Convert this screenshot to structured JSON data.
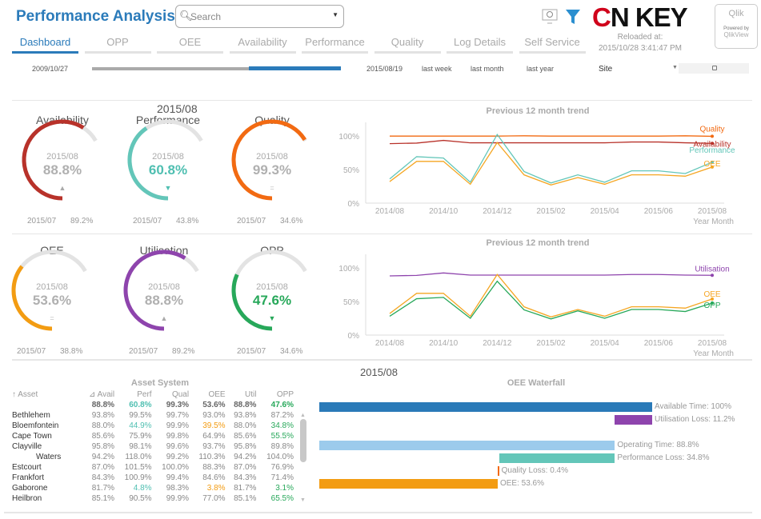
{
  "header": {
    "title": "Performance Analysis",
    "search_placeholder": "Search",
    "logo_text": "ONKEY",
    "logo_c": "C",
    "logo_rest": "N KEY",
    "qlik_brand": "Qlik",
    "qlik_powered": "Powered by",
    "qlik_product": "QlikView",
    "reloaded_label": "Reloaded at:",
    "reloaded_value": "2015/10/28  3:41:47 PM",
    "icons": [
      "monitor-search-icon",
      "filter-icon"
    ]
  },
  "tabs": [
    {
      "label": "Dashboard",
      "active": true
    },
    {
      "label": "OPP"
    },
    {
      "label": "OEE"
    },
    {
      "label": "Availability"
    },
    {
      "label": "Performance"
    },
    {
      "label": "Quality"
    },
    {
      "label": "Log Details"
    },
    {
      "label": "Self Service"
    }
  ],
  "controls": {
    "start_date": "2009/10/27",
    "end_date": "2015/08/19",
    "last_week": "last week",
    "last_month": "last month",
    "last_year": "last year",
    "site_label": "Site",
    "range_selected": [
      0.63,
      1.0
    ],
    "accent": "#2b7bba"
  },
  "gauge_header": "2015/08",
  "gauges": [
    {
      "title": "Availability",
      "period": "2015/08",
      "value": "88.8%",
      "fraction": 0.888,
      "trend": "▲",
      "prev_period": "2015/07",
      "prev_value": "89.2%",
      "color": "#b8322a",
      "value_color": "#b0b0b0",
      "trend_color": "#aaa"
    },
    {
      "title": "Performance",
      "period": "2015/08",
      "value": "60.8%",
      "fraction": 0.608,
      "trend": "▼",
      "prev_period": "2015/07",
      "prev_value": "43.8%",
      "color": "#63c6b9",
      "value_color": "#4fbfb1",
      "trend_color": "#4fbfb1"
    },
    {
      "title": "Quality",
      "period": "2015/08",
      "value": "99.3%",
      "fraction": 0.993,
      "trend": "=",
      "prev_period": "2015/07",
      "prev_value": "34.6%",
      "color": "#f26a12",
      "value_color": "#b0b0b0",
      "trend_color": "#bbb"
    },
    {
      "title": "OEE",
      "period": "2015/08",
      "value": "53.6%",
      "fraction": 0.536,
      "trend": "=",
      "prev_period": "2015/07",
      "prev_value": "38.8%",
      "color": "#f39c12",
      "value_color": "#b0b0b0",
      "trend_color": "#bbb"
    },
    {
      "title": "Utilisation",
      "period": "2015/08",
      "value": "88.8%",
      "fraction": 0.888,
      "trend": "▲",
      "prev_period": "2015/07",
      "prev_value": "89.2%",
      "color": "#8e44ad",
      "value_color": "#b0b0b0",
      "trend_color": "#aaa"
    },
    {
      "title": "OPP",
      "period": "2015/08",
      "value": "47.6%",
      "fraction": 0.476,
      "trend": "▼",
      "prev_period": "2015/07",
      "prev_value": "34.6%",
      "color": "#27a85a",
      "value_color": "#27a85a",
      "trend_color": "#27a85a"
    }
  ],
  "chart_data": [
    {
      "type": "line",
      "title": "Previous 12 month trend",
      "xlabel": "Year Month",
      "ylim": [
        0,
        120
      ],
      "yticks": [
        "0%",
        "50%",
        "100%"
      ],
      "x": [
        "2014/08",
        "2014/09",
        "2014/10",
        "2014/11",
        "2014/12",
        "2015/01",
        "2015/02",
        "2015/03",
        "2015/04",
        "2015/05",
        "2015/06",
        "2015/07",
        "2015/08"
      ],
      "xtick_labels": [
        "2014/08",
        "2014/10",
        "2014/12",
        "2015/02",
        "2015/04",
        "2015/06",
        "2015/08"
      ],
      "series": [
        {
          "name": "Quality",
          "color": "#f26a12",
          "values": [
            99.6,
            99.6,
            99.6,
            99.6,
            99.6,
            100,
            99.6,
            99.6,
            99.6,
            99.6,
            99.6,
            100,
            99.3
          ]
        },
        {
          "name": "Availability",
          "color": "#b8322a",
          "values": [
            88.4,
            89.2,
            93.2,
            89.6,
            89.6,
            89.6,
            89.6,
            89.6,
            89.6,
            90.8,
            90.8,
            89.6,
            88.8
          ]
        },
        {
          "name": "Performance",
          "color": "#63c6b9",
          "values": [
            36,
            69,
            67,
            31,
            102,
            47,
            30,
            42,
            31,
            48,
            48,
            44,
            60.8
          ]
        },
        {
          "name": "OEE",
          "color": "#f5a623",
          "values": [
            32,
            62,
            62,
            28,
            90,
            42,
            27,
            38,
            28,
            42,
            42,
            40,
            53.6
          ]
        }
      ]
    },
    {
      "type": "line",
      "title": "Previous 12 month trend",
      "xlabel": "Year Month",
      "ylim": [
        0,
        120
      ],
      "yticks": [
        "0%",
        "50%",
        "100%"
      ],
      "x": [
        "2014/08",
        "2014/09",
        "2014/10",
        "2014/11",
        "2014/12",
        "2015/01",
        "2015/02",
        "2015/03",
        "2015/04",
        "2015/05",
        "2015/06",
        "2015/07",
        "2015/08"
      ],
      "xtick_labels": [
        "2014/08",
        "2014/10",
        "2014/12",
        "2015/02",
        "2015/04",
        "2015/06",
        "2015/08"
      ],
      "series": [
        {
          "name": "Utilisation",
          "color": "#8e44ad",
          "values": [
            87.9,
            88.7,
            92.3,
            89.1,
            89.1,
            89.1,
            89.1,
            89.1,
            89.1,
            90,
            90,
            89.1,
            88.8
          ]
        },
        {
          "name": "OEE",
          "color": "#f5a623",
          "values": [
            32,
            62,
            62,
            28,
            90,
            42,
            27,
            38,
            28,
            42,
            42,
            40,
            53.6
          ]
        },
        {
          "name": "OPP",
          "color": "#27a85a",
          "values": [
            28,
            54,
            56,
            25,
            80,
            37.5,
            24,
            36,
            25,
            38,
            38,
            35,
            47.6
          ]
        }
      ]
    }
  ],
  "table": {
    "title": "Asset System",
    "columns": [
      "Asset",
      "Avail",
      "Perf",
      "Qual",
      "OEE",
      "Util",
      "OPP"
    ],
    "totals": [
      "",
      "88.8%",
      "60.8%",
      "99.3%",
      "53.6%",
      "88.8%",
      "47.6%"
    ],
    "rows": [
      [
        "Bethlehem",
        "93.8%",
        "99.5%",
        "99.7%",
        "93.0%",
        "93.8%",
        "87.2%"
      ],
      [
        "Bloemfontein",
        "88.0%",
        "44.9%",
        "99.9%",
        "39.5%",
        "88.0%",
        "34.8%"
      ],
      [
        "Cape Town",
        "85.6%",
        "75.9%",
        "99.8%",
        "64.9%",
        "85.6%",
        "55.5%"
      ],
      [
        "Clayville",
        "95.8%",
        "98.1%",
        "99.6%",
        "93.7%",
        "95.8%",
        "89.8%"
      ],
      [
        "Waters",
        "94.2%",
        "118.0%",
        "99.2%",
        "110.3%",
        "94.2%",
        "104.0%"
      ],
      [
        "Estcourt",
        "87.0%",
        "101.5%",
        "100.0%",
        "88.3%",
        "87.0%",
        "76.9%"
      ],
      [
        "Frankfort",
        "84.3%",
        "100.9%",
        "99.4%",
        "84.6%",
        "84.3%",
        "71.4%"
      ],
      [
        "Gaborone",
        "81.7%",
        "4.8%",
        "98.3%",
        "3.8%",
        "81.7%",
        "3.1%"
      ],
      [
        "Heilbron",
        "85.1%",
        "90.5%",
        "99.9%",
        "77.0%",
        "85.1%",
        "65.5%"
      ]
    ]
  },
  "waterfall": {
    "period": "2015/08",
    "title": "OEE Waterfall",
    "bars": [
      {
        "label": "Available Time: 100%",
        "start": 0,
        "end": 100,
        "color": "#2a7ab8"
      },
      {
        "label": "Utilisation Loss: 11.2%",
        "start": 88.8,
        "end": 100,
        "color": "#8e44ad"
      },
      {
        "label": "",
        "start": 0,
        "end": 0,
        "color": "#fff"
      },
      {
        "label": "Operating Time: 88.8%",
        "start": 0,
        "end": 88.8,
        "color": "#9ccbec"
      },
      {
        "label": "Performance Loss: 34.8%",
        "start": 54,
        "end": 88.8,
        "color": "#63c6b9"
      },
      {
        "label": "Quality Loss: 0.4%",
        "start": 53.6,
        "end": 54,
        "color": "#f26a12"
      },
      {
        "label": "OEE: 53.6%",
        "start": 0,
        "end": 53.6,
        "color": "#f39c12"
      }
    ]
  }
}
